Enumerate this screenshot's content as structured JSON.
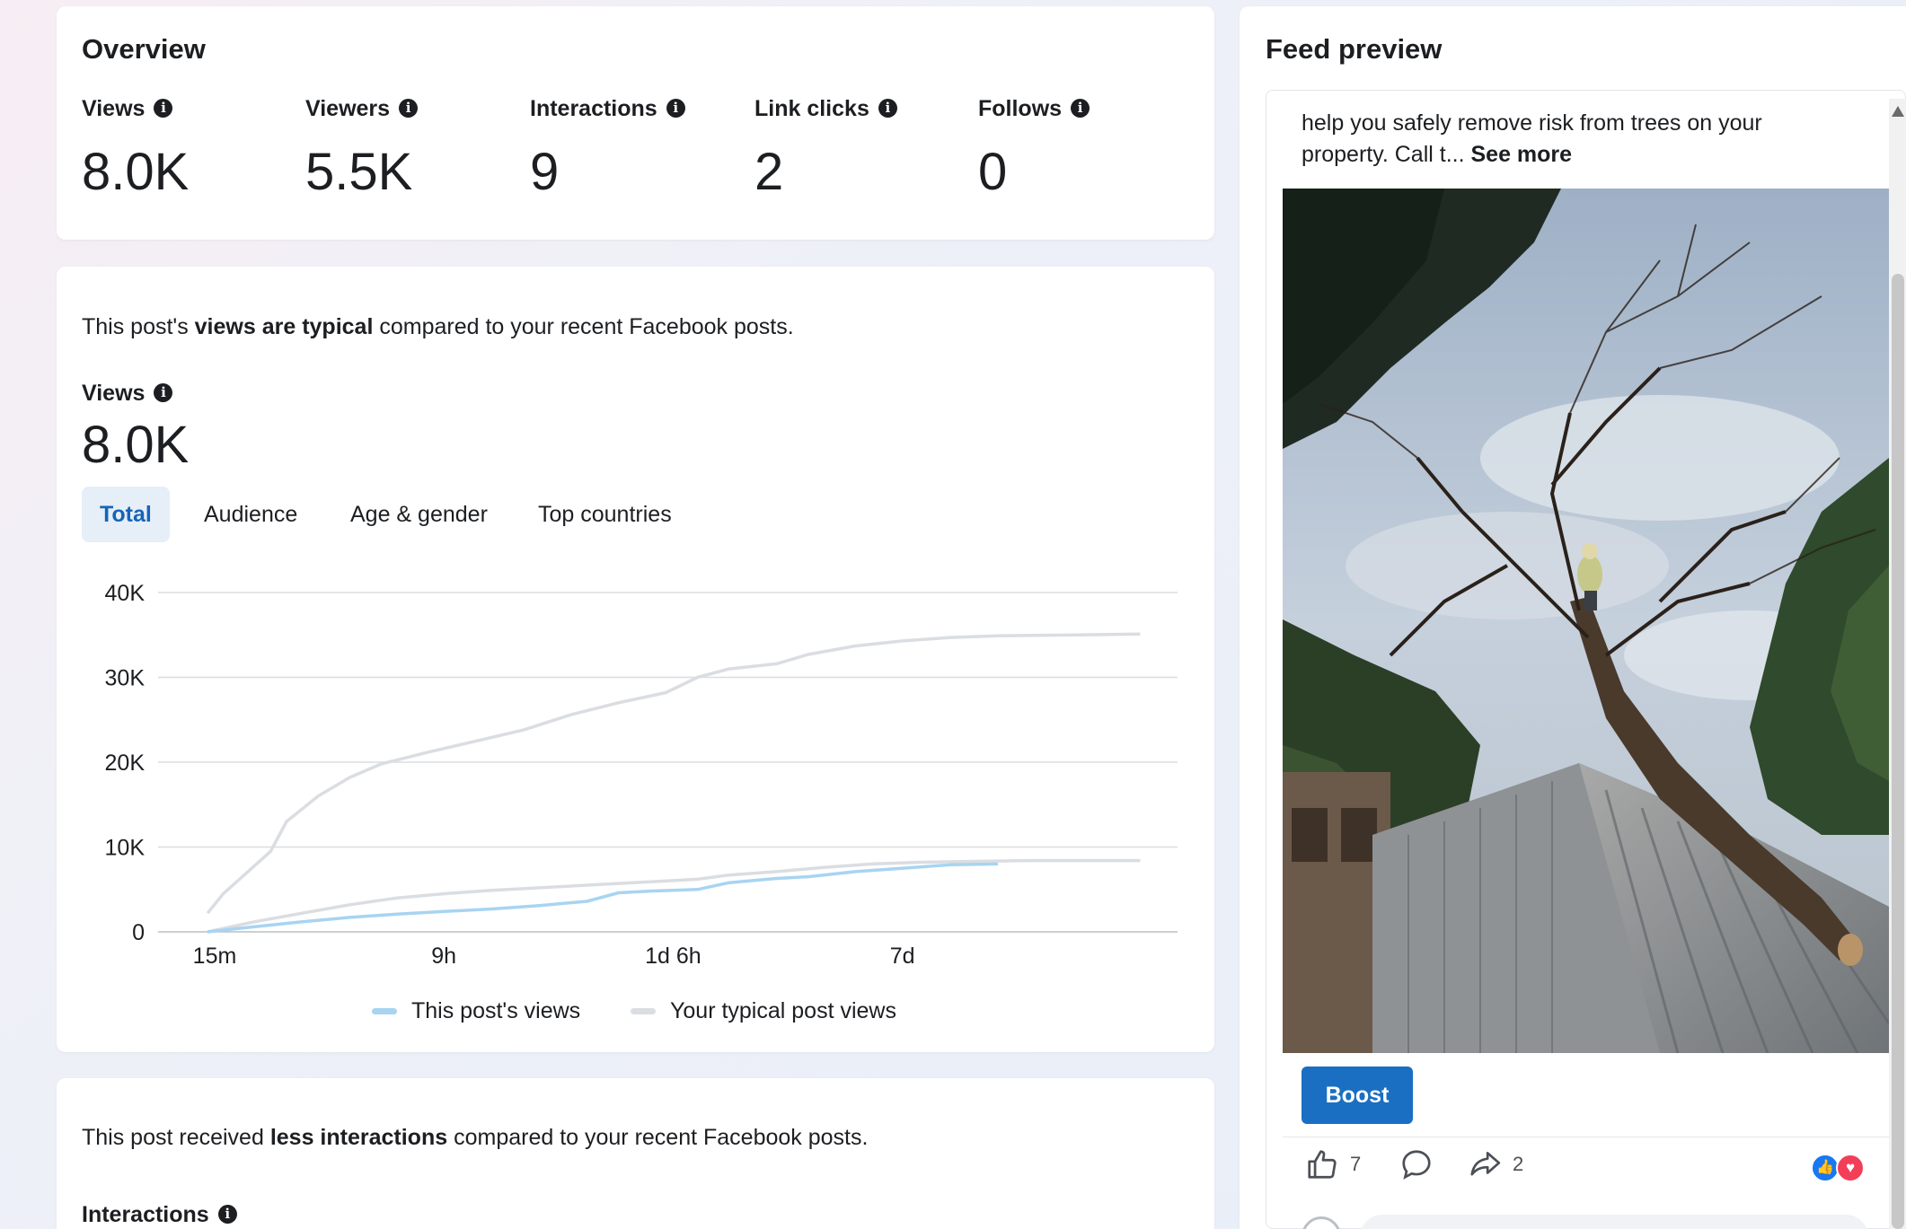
{
  "overview": {
    "title": "Overview",
    "metrics": [
      {
        "label": "Views",
        "value": "8.0K"
      },
      {
        "label": "Viewers",
        "value": "5.5K"
      },
      {
        "label": "Interactions",
        "value": "9"
      },
      {
        "label": "Link clicks",
        "value": "2"
      },
      {
        "label": "Follows",
        "value": "0"
      }
    ]
  },
  "views_section": {
    "sentence_pre": "This post's ",
    "sentence_bold": "views are typical",
    "sentence_post": " compared to your recent Facebook posts.",
    "metric_label": "Views",
    "metric_value": "8.0K",
    "tabs": [
      {
        "label": "Total",
        "active": true
      },
      {
        "label": "Audience",
        "active": false
      },
      {
        "label": "Age & gender",
        "active": false
      },
      {
        "label": "Top countries",
        "active": false
      }
    ],
    "legend": [
      {
        "label": "This post's views",
        "color": "#a8d4f2"
      },
      {
        "label": "Your typical post views",
        "color": "#dadde1"
      }
    ]
  },
  "interactions_section": {
    "sentence_pre": "This post received ",
    "sentence_bold": "less interactions",
    "sentence_post": " compared to your recent Facebook posts.",
    "metric_label": "Interactions"
  },
  "feed_preview": {
    "title": "Feed preview",
    "post_text_line1": "help you safely remove risk from trees on your",
    "post_text_line2": "property.  Call t...",
    "see_more": "See more",
    "boost_label": "Boost",
    "like_count": "7",
    "share_count": "2"
  },
  "colors": {
    "accent": "#1b6fc2",
    "this_post_line": "#a8d4f2",
    "typical_line": "#dadde1",
    "active_tab_bg": "#e6eef8",
    "active_tab_text": "#1565b8"
  },
  "icons": [
    "info-icon",
    "like-icon",
    "comment-icon",
    "share-icon",
    "like-reaction-icon",
    "love-reaction-icon"
  ],
  "chart_data": {
    "type": "line",
    "x": [
      "15m",
      "",
      "",
      "",
      "",
      "",
      "",
      "",
      "",
      "",
      "",
      "",
      "",
      "",
      "",
      "",
      "",
      "",
      "",
      ""
    ],
    "x_tick_labels": [
      "15m",
      "9h",
      "1d 6h",
      "7d"
    ],
    "y_tick_labels": [
      "0",
      "10K",
      "20K",
      "30K",
      "40K"
    ],
    "ylim": [
      0,
      40000
    ],
    "grid": true,
    "legend_position": "bottom",
    "series": [
      {
        "name": "This post's views",
        "color": "#a8d4f2",
        "points": [
          [
            0,
            0
          ],
          [
            0.06,
            600
          ],
          [
            0.12,
            1200
          ],
          [
            0.18,
            1700
          ],
          [
            0.24,
            2100
          ],
          [
            0.3,
            2400
          ],
          [
            0.36,
            2700
          ],
          [
            0.42,
            3100
          ],
          [
            0.48,
            3600
          ],
          [
            0.52,
            4600
          ],
          [
            0.56,
            4800
          ],
          [
            0.62,
            5000
          ],
          [
            0.66,
            5800
          ],
          [
            0.72,
            6300
          ],
          [
            0.76,
            6500
          ],
          [
            0.82,
            7100
          ],
          [
            0.88,
            7500
          ],
          [
            0.94,
            7900
          ],
          [
            1.0,
            8000
          ]
        ]
      },
      {
        "name": "Your typical post views",
        "color": "#dadde1",
        "points": [
          [
            0,
            2200
          ],
          [
            0.02,
            4500
          ],
          [
            0.05,
            7000
          ],
          [
            0.08,
            9500
          ],
          [
            0.1,
            13000
          ],
          [
            0.14,
            16000
          ],
          [
            0.18,
            18200
          ],
          [
            0.22,
            19800
          ],
          [
            0.28,
            21200
          ],
          [
            0.34,
            22500
          ],
          [
            0.4,
            23800
          ],
          [
            0.46,
            25600
          ],
          [
            0.52,
            27000
          ],
          [
            0.58,
            28200
          ],
          [
            0.62,
            30000
          ],
          [
            0.66,
            31000
          ],
          [
            0.72,
            31600
          ],
          [
            0.76,
            32700
          ],
          [
            0.82,
            33700
          ],
          [
            0.88,
            34300
          ],
          [
            0.94,
            34700
          ],
          [
            1.0,
            34900
          ],
          [
            1.1,
            35000
          ],
          [
            1.18,
            35100
          ]
        ]
      },
      {
        "name": "",
        "color": "#dadde1",
        "points": [
          [
            0,
            0
          ],
          [
            0.06,
            1200
          ],
          [
            0.12,
            2200
          ],
          [
            0.18,
            3200
          ],
          [
            0.24,
            4000
          ],
          [
            0.3,
            4500
          ],
          [
            0.36,
            4900
          ],
          [
            0.42,
            5200
          ],
          [
            0.48,
            5500
          ],
          [
            0.52,
            5700
          ],
          [
            0.56,
            5900
          ],
          [
            0.62,
            6200
          ],
          [
            0.66,
            6700
          ],
          [
            0.72,
            7100
          ],
          [
            0.78,
            7600
          ],
          [
            0.84,
            8000
          ],
          [
            0.9,
            8200
          ],
          [
            0.96,
            8300
          ],
          [
            1.04,
            8400
          ],
          [
            1.12,
            8400
          ],
          [
            1.18,
            8400
          ]
        ]
      }
    ]
  }
}
